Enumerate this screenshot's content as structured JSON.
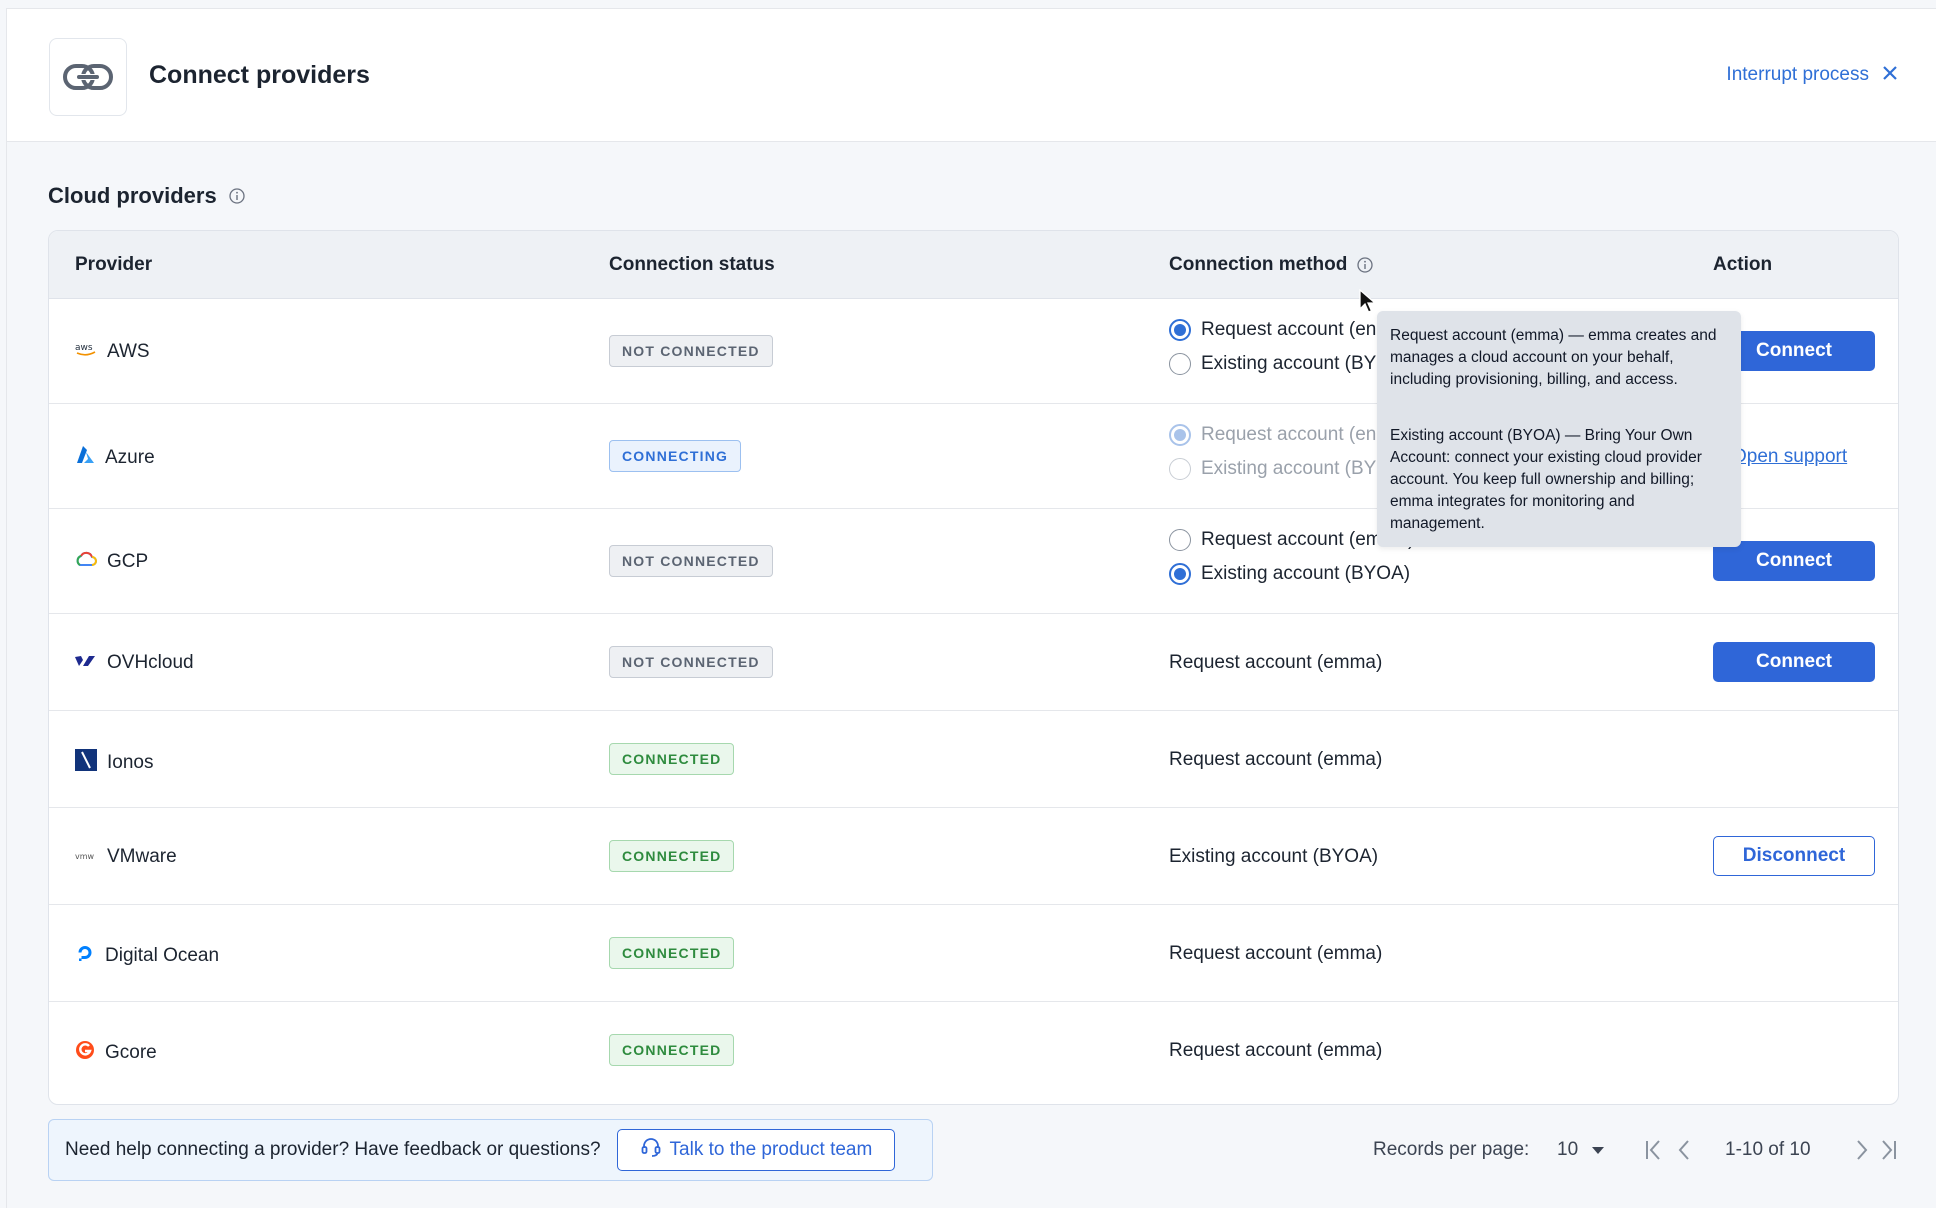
{
  "header": {
    "title": "Connect providers",
    "interrupt_label": "Interrupt process"
  },
  "section": {
    "title": "Cloud providers"
  },
  "table": {
    "columns": {
      "provider": "Provider",
      "status": "Connection status",
      "method": "Connection method",
      "action": "Action"
    },
    "rows": [
      {
        "name": "AWS",
        "status": "NOT CONNECTED",
        "method_a": "Request account (en",
        "method_b": "Existing account (BY",
        "action": "Connect"
      },
      {
        "name": "Azure",
        "status": "CONNECTING",
        "method_a": "Request account (en",
        "method_b": "Existing account (BY",
        "action": "Open support"
      },
      {
        "name": "GCP",
        "status": "NOT CONNECTED",
        "method_a": "Request account (emma)",
        "method_b": "Existing account (BYOA)",
        "action": "Connect"
      },
      {
        "name": "OVHcloud",
        "status": "NOT CONNECTED",
        "method": "Request account (emma)",
        "action": "Connect"
      },
      {
        "name": "Ionos",
        "status": "CONNECTED",
        "method": "Request account (emma)"
      },
      {
        "name": "VMware",
        "status": "CONNECTED",
        "method": "Existing account (BYOA)",
        "action": "Disconnect"
      },
      {
        "name": "Digital Ocean",
        "status": "CONNECTED",
        "method": "Request account (emma)"
      },
      {
        "name": "Gcore",
        "status": "CONNECTED",
        "method": "Request account (emma)"
      }
    ]
  },
  "tooltip": {
    "p1": "Request account (emma) — emma creates and manages a cloud account on your behalf, including provisioning, billing, and access.",
    "p2": "Existing account (BYOA) — Bring Your Own Account: connect your existing cloud provider account. You keep full ownership and billing; emma integrates for monitoring and management."
  },
  "footer": {
    "help_text": "Need help connecting a provider? Have feedback or questions?",
    "talk_button": "Talk to the product team",
    "records_label": "Records per page:",
    "records_value": "10",
    "range": "1-10 of 10"
  },
  "icons": {
    "aws": "aws-logo-icon",
    "azure": "azure-logo-icon",
    "gcp": "gcp-logo-icon",
    "ovh": "ovhcloud-logo-icon",
    "ionos": "ionos-logo-icon",
    "vmware": "vmware-logo-icon",
    "digitalocean": "digitalocean-logo-icon",
    "gcore": "gcore-logo-icon"
  },
  "colors": {
    "accent": "#2f66d8",
    "connected": "#2e8b3e",
    "connecting": "#2f6fd6",
    "not_connected": "#5b6472"
  }
}
